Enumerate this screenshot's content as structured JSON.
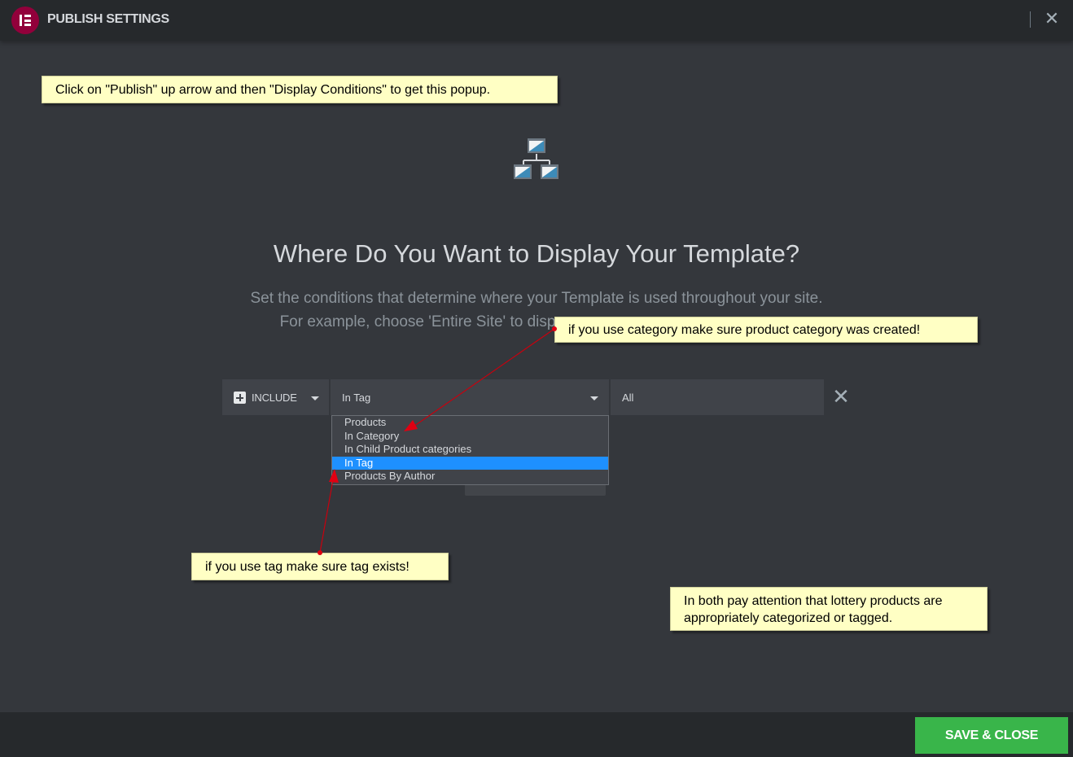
{
  "header": {
    "title": "PUBLISH SETTINGS",
    "logo_icon": "elementor-logo",
    "close_icon": "close-icon",
    "logo_color": "#92003b"
  },
  "notes": {
    "top": "Click on \"Publish\" up arrow and then \"Display Conditions\" to get this popup.",
    "category": "if you use category make sure product category was created!",
    "tag": "if you use tag make sure tag exists!",
    "both": "In both pay attention that lottery products are appropriately categorized or tagged."
  },
  "main": {
    "icon": "sitemap-icon",
    "headline": "Where Do You Want to Display Your Template?",
    "description_line1": "Set the conditions that determine where your Template is used throughout your site.",
    "description_line2": "For example, choose 'Entire Site' to disp"
  },
  "condition": {
    "include_label": "INCLUDE",
    "type_value": "In Tag",
    "target_value": "All",
    "options": [
      "Products",
      "In Category",
      "In Child Product categories",
      "In Tag",
      "Products By Author"
    ],
    "selected_option": "In Tag"
  },
  "footer": {
    "save_label": "SAVE & CLOSE",
    "save_color": "#39b54a"
  }
}
